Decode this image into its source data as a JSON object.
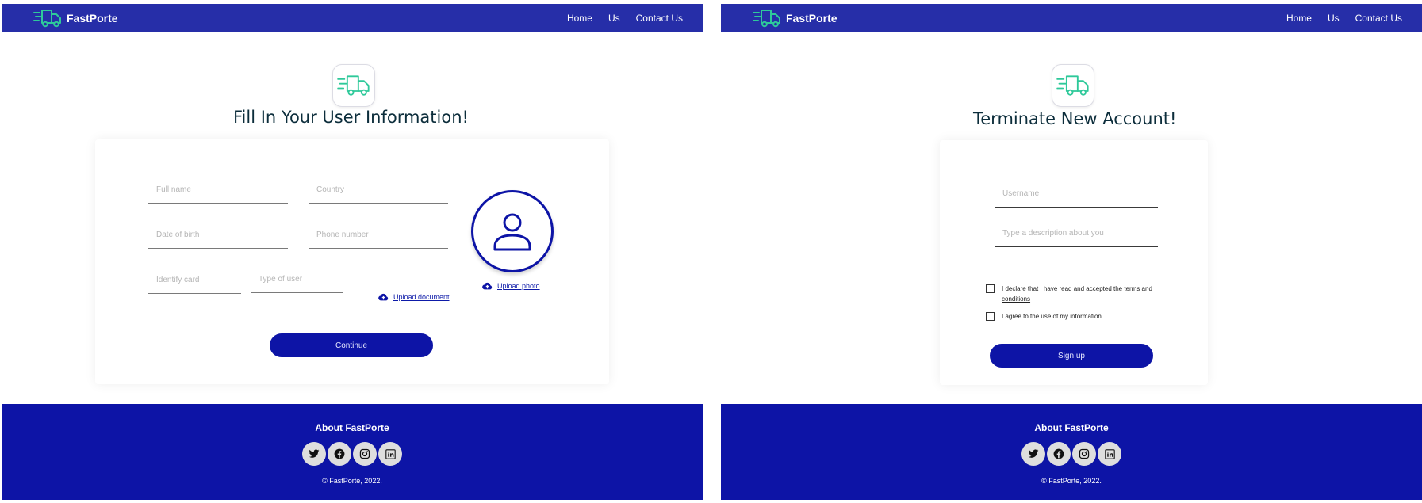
{
  "colors": {
    "nav": "#262ea8",
    "primary": "#0d14a6",
    "logo_green": "#2ec99a"
  },
  "screens": [
    {
      "brand": "FastPorte",
      "nav": [
        "Home",
        "Us",
        "Contact Us"
      ],
      "title": "Fill In Your User Information!",
      "fields": {
        "full_name": "Full name",
        "country": "Country",
        "date_of_birth": "Date of birth",
        "phone_number": "Phone number",
        "identify_card": "Identify card",
        "type_of_user": "Type of user"
      },
      "upload_document": "Upload document",
      "upload_photo": "Upload photo",
      "continue": "Continue",
      "footer": {
        "title": "About FastPorte",
        "copyright": "© FastPorte, 2022."
      }
    },
    {
      "brand": "FastPorte",
      "nav": [
        "Home",
        "Us",
        "Contact Us"
      ],
      "title": "Terminate New Account!",
      "fields": {
        "username": "Username",
        "description": "Type a description about you"
      },
      "checks": {
        "terms_prefix": "I declare that I have read and accepted the ",
        "terms_link": "terms and conditions",
        "consent": "I agree to the use of my information."
      },
      "sign_up": "Sign up",
      "footer": {
        "title": "About FastPorte",
        "copyright": "© FastPorte, 2022."
      }
    }
  ],
  "icons": [
    "truck-icon",
    "cloud-upload-icon",
    "user-icon",
    "twitter-icon",
    "facebook-icon",
    "instagram-icon",
    "linkedin-icon"
  ]
}
